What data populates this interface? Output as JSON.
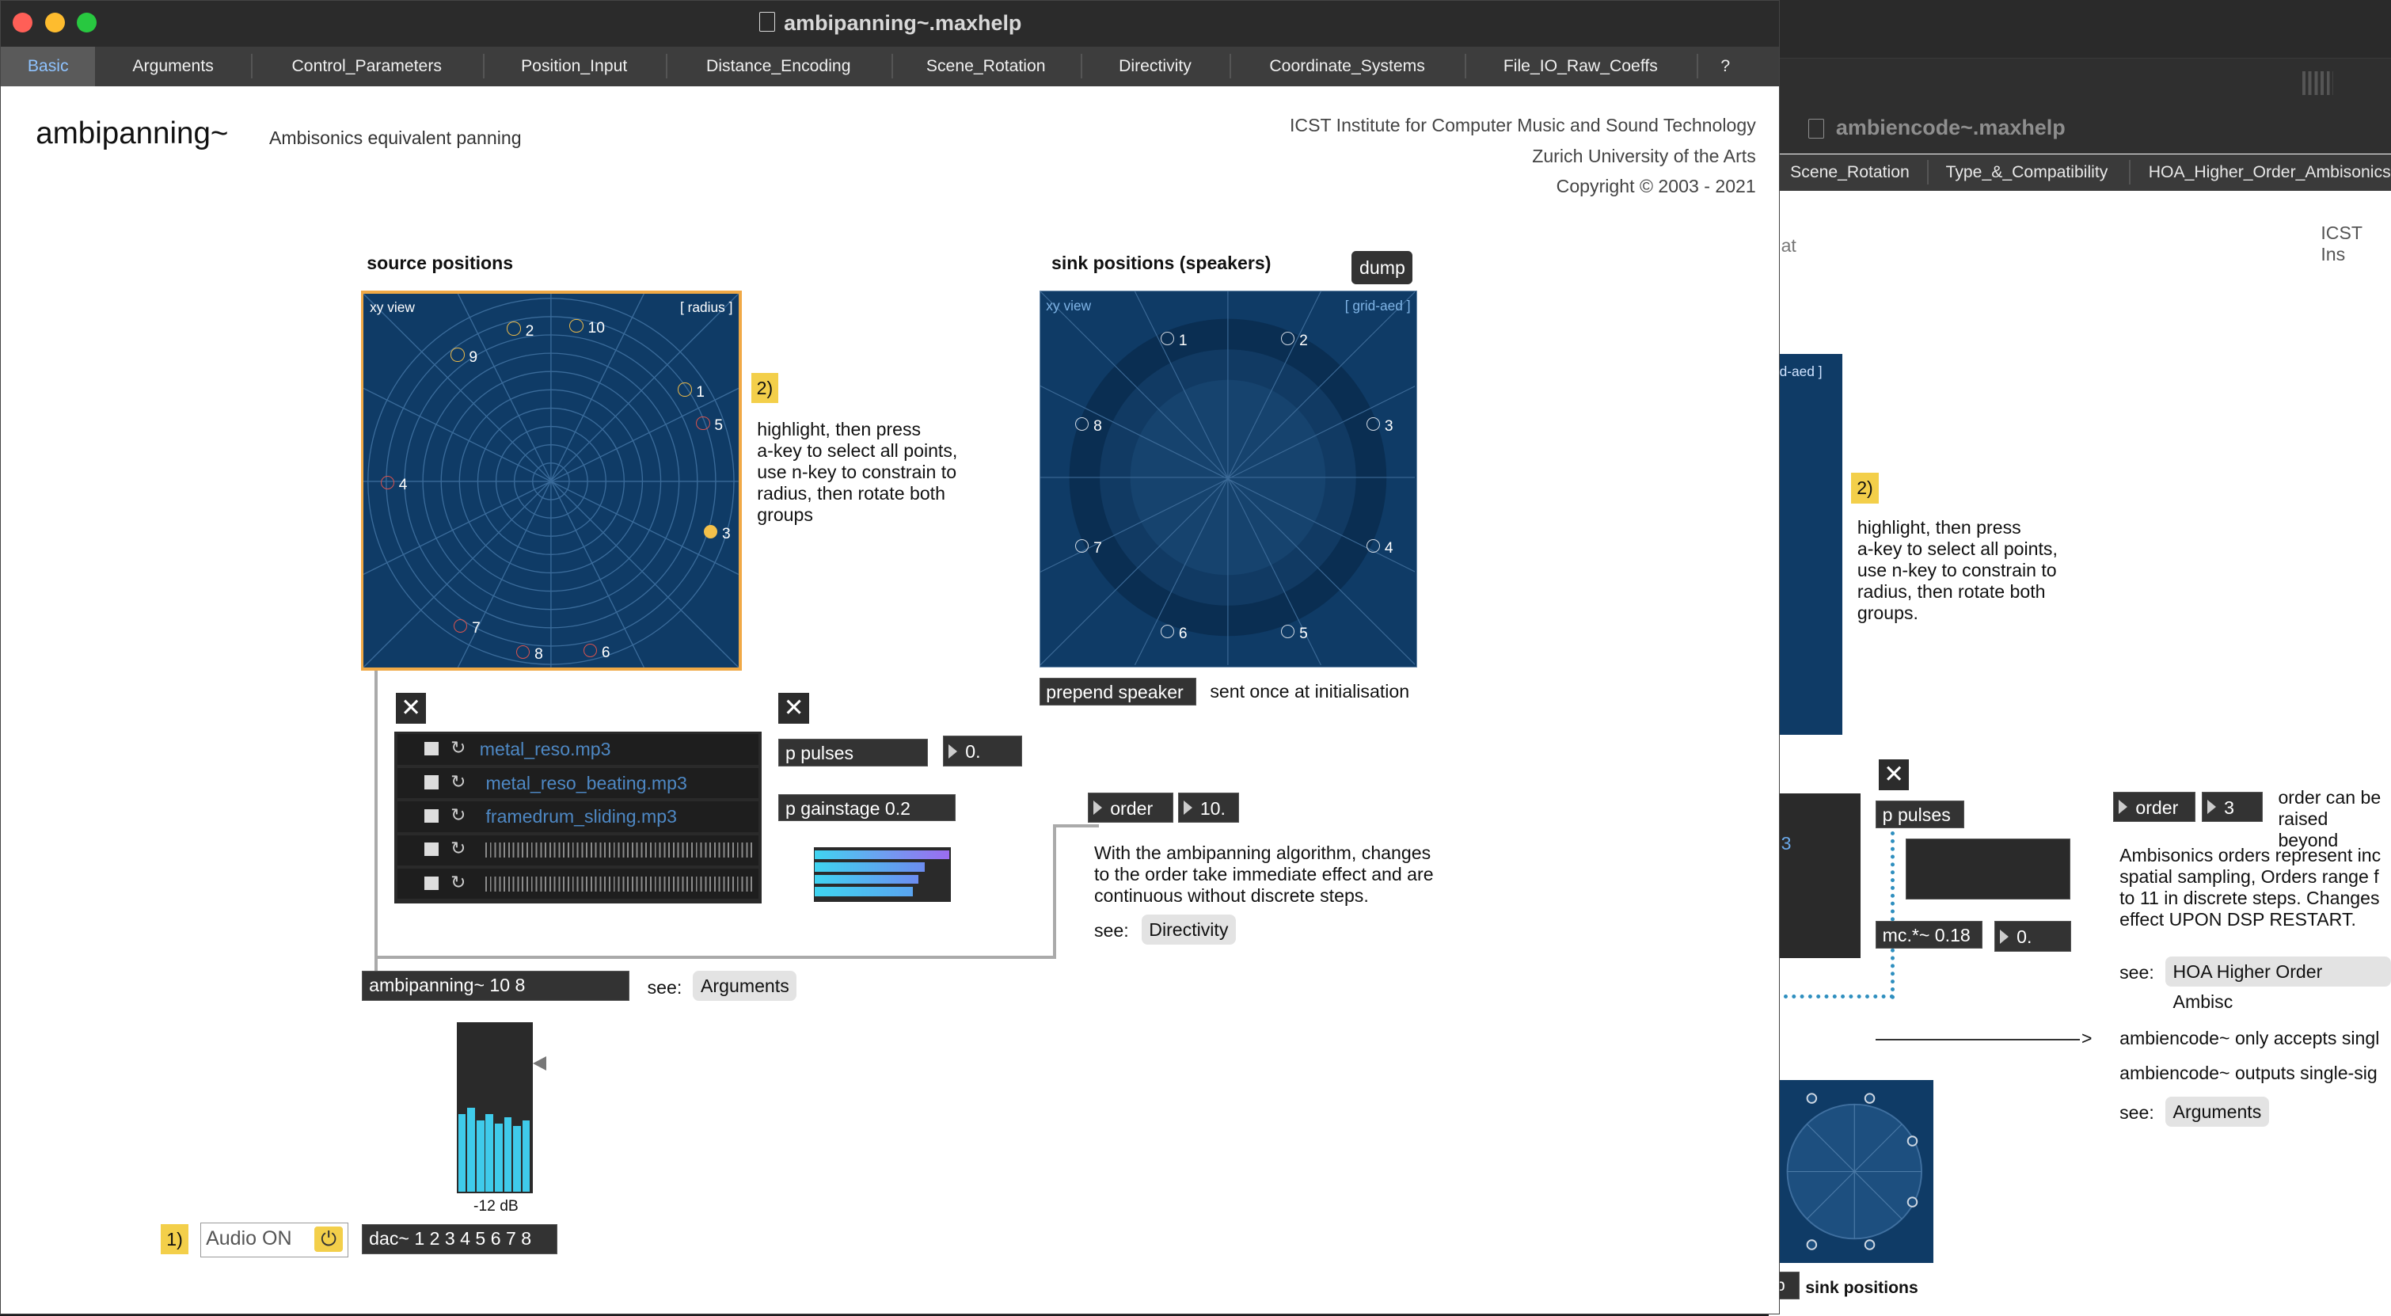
{
  "window": {
    "title": "ambipanning~.maxhelp",
    "tabs": [
      {
        "label": "Basic",
        "active": true
      },
      {
        "label": "Arguments"
      },
      {
        "label": "Control_Parameters"
      },
      {
        "label": "Position_Input"
      },
      {
        "label": "Distance_Encoding"
      },
      {
        "label": "Scene_Rotation"
      },
      {
        "label": "Directivity"
      },
      {
        "label": "Coordinate_Systems"
      },
      {
        "label": "File_IO_Raw_Coeffs"
      },
      {
        "label": "?"
      }
    ]
  },
  "header": {
    "title": "ambipanning~",
    "subtitle": "Ambisonics equivalent panning",
    "credit_1": "ICST Institute for Computer Music and Sound Technology",
    "credit_2": "Zurich University of the Arts",
    "credit_3": "Copyright © 2003 - 2021"
  },
  "source_panel": {
    "heading": "source positions",
    "view_label": "xy view",
    "mode_label": "[ radius ]",
    "points": [
      {
        "id": "1",
        "color": "#e8b84a"
      },
      {
        "id": "2",
        "color": "#e8b84a"
      },
      {
        "id": "3",
        "color": "#f3c04a"
      },
      {
        "id": "4",
        "color": "#d9534f"
      },
      {
        "id": "5",
        "color": "#d9534f"
      },
      {
        "id": "6",
        "color": "#d9534f"
      },
      {
        "id": "7",
        "color": "#d9534f"
      },
      {
        "id": "8",
        "color": "#d9534f"
      },
      {
        "id": "9",
        "color": "#e8b84a"
      },
      {
        "id": "10",
        "color": "#e8b84a"
      }
    ]
  },
  "sink_panel": {
    "heading": "sink positions (speakers)",
    "dump_label": "dump",
    "view_label": "xy view",
    "mode_label": "[ grid-aed ]",
    "speakers": [
      "1",
      "2",
      "3",
      "4",
      "5",
      "6",
      "7",
      "8"
    ]
  },
  "hint": {
    "badge": "2)",
    "text_1": "highlight, then press",
    "text_2": "a-key to select all points,",
    "text_3": "use n-key to constrain to",
    "text_4": "radius, then rotate both",
    "text_5": "groups"
  },
  "player": {
    "files": [
      "metal_reso.mp3",
      "metal_reso_beating.mp3",
      "framedrum_sliding.mp3",
      "",
      ""
    ]
  },
  "objects": {
    "prepend": "prepend speaker",
    "sent_once": "sent once at initialisation",
    "p_pulses": "p pulses",
    "pulses_num": "0.",
    "gainstage": "p gainstage 0.2",
    "order_label": "order",
    "order_value": "10.",
    "order_note_1": "With the ambipanning algorithm, changes",
    "order_note_2": "to the order take immediate effect and are",
    "order_note_3": "continuous without discrete steps.",
    "see1": "see:",
    "see1_btn": "Directivity",
    "ambipanning": "ambipanning~ 10 8",
    "see2": "see:",
    "see2_btn": "Arguments",
    "meter_label": "-12 dB",
    "audio_badge": "1)",
    "audio_on": "Audio ON",
    "dac": "dac~ 1 2 3 4 5 6 7 8"
  },
  "background_window": {
    "title": "ambiencode~.maxhelp",
    "tabs": [
      "Scene_Rotation",
      "Type_&_Compatibility",
      "HOA_Higher_Order_Ambisonics"
    ],
    "credit_fragment": "ICST Ins",
    "fragment_at": "at",
    "mode_label": "rid-aed ]",
    "hint_badge": "2)",
    "hint_1": "highlight, then press",
    "hint_2": "a-key to select all points,",
    "hint_3": "use n-key to constrain to",
    "hint_4": "radius, then rotate both",
    "hint_5": "groups.",
    "p_pulses": "p pulses",
    "order_label": "order",
    "order_value": "3",
    "order_note_1": "order can be",
    "order_note_2": "raised beyond",
    "mc_obj": "mc.*~ 0.18",
    "mc_num": "0.",
    "pulses_fragment": "3",
    "amb_1": "Ambisonics orders represent inc",
    "amb_2": "spatial sampling, Orders range f",
    "amb_3": "to 11 in discrete steps. Changes",
    "amb_4": "effect UPON DSP RESTART.",
    "see_label": "see:",
    "see_btn": "HOA Higher Order Ambisc",
    "arrow": ">",
    "accepts": "ambiencode~ only accepts singl",
    "outputs": "ambiencode~ outputs single-sig",
    "see2_label": "see:",
    "see2_btn": "Arguments",
    "p_fragment": "p",
    "sink_label": "sink positions"
  }
}
